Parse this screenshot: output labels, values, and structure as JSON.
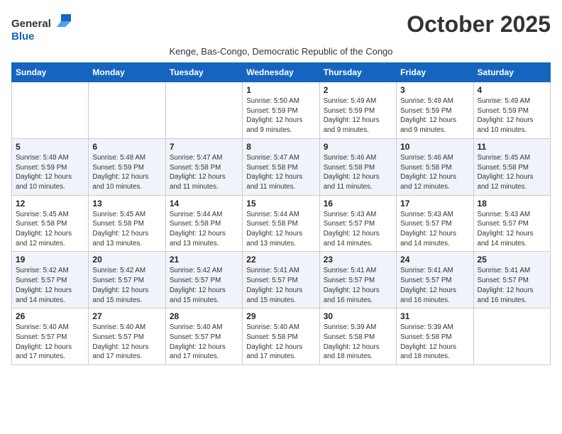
{
  "logo": {
    "general": "General",
    "blue": "Blue"
  },
  "header": {
    "month_title": "October 2025",
    "subtitle": "Kenge, Bas-Congo, Democratic Republic of the Congo"
  },
  "days_of_week": [
    "Sunday",
    "Monday",
    "Tuesday",
    "Wednesday",
    "Thursday",
    "Friday",
    "Saturday"
  ],
  "weeks": [
    [
      {
        "day": "",
        "info": ""
      },
      {
        "day": "",
        "info": ""
      },
      {
        "day": "",
        "info": ""
      },
      {
        "day": "1",
        "info": "Sunrise: 5:50 AM\nSunset: 5:59 PM\nDaylight: 12 hours\nand 9 minutes."
      },
      {
        "day": "2",
        "info": "Sunrise: 5:49 AM\nSunset: 5:59 PM\nDaylight: 12 hours\nand 9 minutes."
      },
      {
        "day": "3",
        "info": "Sunrise: 5:49 AM\nSunset: 5:59 PM\nDaylight: 12 hours\nand 9 minutes."
      },
      {
        "day": "4",
        "info": "Sunrise: 5:49 AM\nSunset: 5:59 PM\nDaylight: 12 hours\nand 10 minutes."
      }
    ],
    [
      {
        "day": "5",
        "info": "Sunrise: 5:48 AM\nSunset: 5:59 PM\nDaylight: 12 hours\nand 10 minutes."
      },
      {
        "day": "6",
        "info": "Sunrise: 5:48 AM\nSunset: 5:59 PM\nDaylight: 12 hours\nand 10 minutes."
      },
      {
        "day": "7",
        "info": "Sunrise: 5:47 AM\nSunset: 5:58 PM\nDaylight: 12 hours\nand 11 minutes."
      },
      {
        "day": "8",
        "info": "Sunrise: 5:47 AM\nSunset: 5:58 PM\nDaylight: 12 hours\nand 11 minutes."
      },
      {
        "day": "9",
        "info": "Sunrise: 5:46 AM\nSunset: 5:58 PM\nDaylight: 12 hours\nand 11 minutes."
      },
      {
        "day": "10",
        "info": "Sunrise: 5:46 AM\nSunset: 5:58 PM\nDaylight: 12 hours\nand 12 minutes."
      },
      {
        "day": "11",
        "info": "Sunrise: 5:45 AM\nSunset: 5:58 PM\nDaylight: 12 hours\nand 12 minutes."
      }
    ],
    [
      {
        "day": "12",
        "info": "Sunrise: 5:45 AM\nSunset: 5:58 PM\nDaylight: 12 hours\nand 12 minutes."
      },
      {
        "day": "13",
        "info": "Sunrise: 5:45 AM\nSunset: 5:58 PM\nDaylight: 12 hours\nand 13 minutes."
      },
      {
        "day": "14",
        "info": "Sunrise: 5:44 AM\nSunset: 5:58 PM\nDaylight: 12 hours\nand 13 minutes."
      },
      {
        "day": "15",
        "info": "Sunrise: 5:44 AM\nSunset: 5:58 PM\nDaylight: 12 hours\nand 13 minutes."
      },
      {
        "day": "16",
        "info": "Sunrise: 5:43 AM\nSunset: 5:57 PM\nDaylight: 12 hours\nand 14 minutes."
      },
      {
        "day": "17",
        "info": "Sunrise: 5:43 AM\nSunset: 5:57 PM\nDaylight: 12 hours\nand 14 minutes."
      },
      {
        "day": "18",
        "info": "Sunrise: 5:43 AM\nSunset: 5:57 PM\nDaylight: 12 hours\nand 14 minutes."
      }
    ],
    [
      {
        "day": "19",
        "info": "Sunrise: 5:42 AM\nSunset: 5:57 PM\nDaylight: 12 hours\nand 14 minutes."
      },
      {
        "day": "20",
        "info": "Sunrise: 5:42 AM\nSunset: 5:57 PM\nDaylight: 12 hours\nand 15 minutes."
      },
      {
        "day": "21",
        "info": "Sunrise: 5:42 AM\nSunset: 5:57 PM\nDaylight: 12 hours\nand 15 minutes."
      },
      {
        "day": "22",
        "info": "Sunrise: 5:41 AM\nSunset: 5:57 PM\nDaylight: 12 hours\nand 15 minutes."
      },
      {
        "day": "23",
        "info": "Sunrise: 5:41 AM\nSunset: 5:57 PM\nDaylight: 12 hours\nand 16 minutes."
      },
      {
        "day": "24",
        "info": "Sunrise: 5:41 AM\nSunset: 5:57 PM\nDaylight: 12 hours\nand 16 minutes."
      },
      {
        "day": "25",
        "info": "Sunrise: 5:41 AM\nSunset: 5:57 PM\nDaylight: 12 hours\nand 16 minutes."
      }
    ],
    [
      {
        "day": "26",
        "info": "Sunrise: 5:40 AM\nSunset: 5:57 PM\nDaylight: 12 hours\nand 17 minutes."
      },
      {
        "day": "27",
        "info": "Sunrise: 5:40 AM\nSunset: 5:57 PM\nDaylight: 12 hours\nand 17 minutes."
      },
      {
        "day": "28",
        "info": "Sunrise: 5:40 AM\nSunset: 5:57 PM\nDaylight: 12 hours\nand 17 minutes."
      },
      {
        "day": "29",
        "info": "Sunrise: 5:40 AM\nSunset: 5:58 PM\nDaylight: 12 hours\nand 17 minutes."
      },
      {
        "day": "30",
        "info": "Sunrise: 5:39 AM\nSunset: 5:58 PM\nDaylight: 12 hours\nand 18 minutes."
      },
      {
        "day": "31",
        "info": "Sunrise: 5:39 AM\nSunset: 5:58 PM\nDaylight: 12 hours\nand 18 minutes."
      },
      {
        "day": "",
        "info": ""
      }
    ]
  ]
}
